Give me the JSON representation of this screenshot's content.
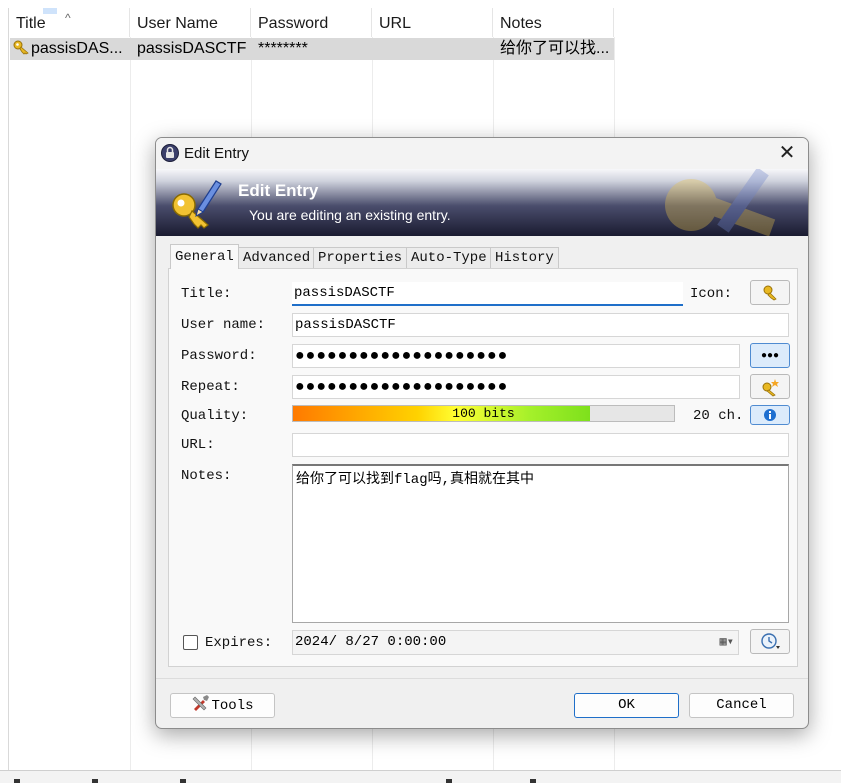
{
  "list": {
    "columns": [
      "Title",
      "User Name",
      "Password",
      "URL",
      "Notes"
    ],
    "rows": [
      {
        "title": "passisDAS...",
        "user": "passisDASCTF",
        "password": "********",
        "url": "",
        "notes": "给你了可以找..."
      }
    ]
  },
  "dialog": {
    "window_title": "Edit Entry",
    "banner_title": "Edit Entry",
    "banner_subtitle": "You are editing an existing entry.",
    "tabs": [
      "General",
      "Advanced",
      "Properties",
      "Auto-Type",
      "History"
    ],
    "active_tab": "General",
    "labels": {
      "title": "Title:",
      "icon": "Icon:",
      "user_name": "User name:",
      "password": "Password:",
      "repeat": "Repeat:",
      "quality": "Quality:",
      "url": "URL:",
      "notes": "Notes:",
      "expires": "Expires:"
    },
    "fields": {
      "title": "passisDASCTF",
      "user_name": "passisDASCTF",
      "password": "●●●●●●●●●●●●●●●●●●●●",
      "repeat": "●●●●●●●●●●●●●●●●●●●●",
      "url": "",
      "notes": "给你了可以找到flag吗,真相就在其中",
      "expires": "2024/ 8/27  0:00:00"
    },
    "quality": {
      "text": "100 bits",
      "fraction": 0.78,
      "char_count": "20 ch."
    },
    "expires_checked": false,
    "buttons": {
      "tools": "Tools",
      "ok": "OK",
      "cancel": "Cancel",
      "show_password": "●●●"
    },
    "colors": {
      "accent": "#1f6fc9",
      "quality_start": "#ff7a00",
      "quality_end": "#7ee01c"
    }
  }
}
